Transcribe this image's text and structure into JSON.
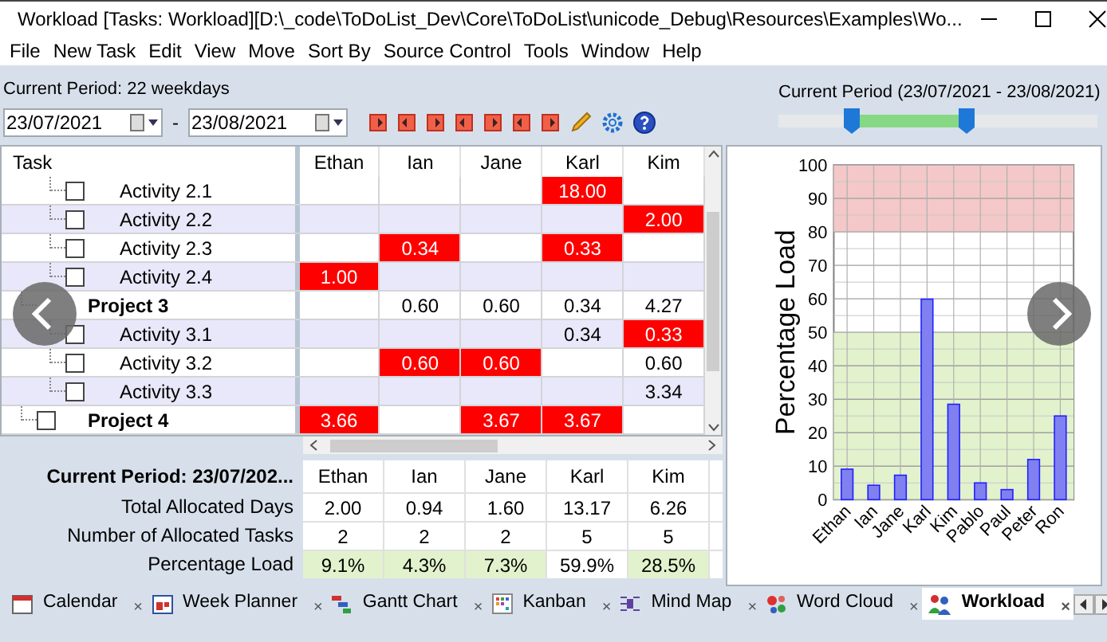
{
  "window": {
    "title": "Workload [Tasks: Workload][D:\\_code\\ToDoList_Dev\\Core\\ToDoList\\unicode_Debug\\Resources\\Examples\\Wo..."
  },
  "menu": [
    "File",
    "New Task",
    "Edit",
    "View",
    "Move",
    "Sort By",
    "Source Control",
    "Tools",
    "Window",
    "Help"
  ],
  "toolbar": {
    "period_text": "Current Period: 22 weekdays",
    "start_date": "23/07/2021",
    "separator": "-",
    "end_date": "23/08/2021",
    "slider_label": "Current Period (23/07/2021 - 23/08/2021)",
    "thumbs": [
      {
        "level": 0.23
      },
      {
        "level": 0.59
      }
    ]
  },
  "grid": {
    "task_header": "Task",
    "columns": [
      "Ethan",
      "Ian",
      "Jane",
      "Karl",
      "Kim"
    ],
    "rows": [
      {
        "task": "Activity 2.1",
        "kind": "activity",
        "checked": false,
        "cells": [
          null,
          null,
          null,
          {
            "value": "18.00",
            "over": true
          },
          null
        ]
      },
      {
        "task": "Activity 2.2",
        "kind": "activity",
        "checked": false,
        "cells": [
          null,
          null,
          null,
          null,
          {
            "value": "2.00",
            "over": true
          }
        ]
      },
      {
        "task": "Activity 2.3",
        "kind": "activity",
        "checked": false,
        "cells": [
          null,
          {
            "value": "0.34",
            "over": true
          },
          null,
          {
            "value": "0.33",
            "over": true
          },
          null
        ]
      },
      {
        "task": "Activity 2.4",
        "kind": "activity",
        "checked": false,
        "cells": [
          {
            "value": "1.00",
            "over": true
          },
          null,
          null,
          null,
          null
        ]
      },
      {
        "task": "Project 3",
        "kind": "project",
        "cells": [
          null,
          {
            "value": "0.60",
            "over": false
          },
          {
            "value": "0.60",
            "over": false
          },
          {
            "value": "0.34",
            "over": false
          },
          {
            "value": "4.27",
            "over": false
          }
        ]
      },
      {
        "task": "Activity 3.1",
        "kind": "activity",
        "checked": false,
        "cells": [
          null,
          null,
          null,
          {
            "value": "0.34",
            "over": false
          },
          {
            "value": "0.33",
            "over": true
          }
        ]
      },
      {
        "task": "Activity 3.2",
        "kind": "activity",
        "checked": false,
        "cells": [
          null,
          {
            "value": "0.60",
            "over": true
          },
          {
            "value": "0.60",
            "over": true
          },
          null,
          {
            "value": "0.60",
            "over": false
          }
        ]
      },
      {
        "task": "Activity 3.3",
        "kind": "activity",
        "checked": false,
        "cells": [
          null,
          null,
          null,
          null,
          {
            "value": "3.34",
            "over": false
          }
        ]
      },
      {
        "task": "Project 4",
        "kind": "project",
        "checked": false,
        "cells": [
          {
            "value": "3.66",
            "over": true
          },
          null,
          {
            "value": "3.67",
            "over": true
          },
          {
            "value": "3.67",
            "over": true
          },
          null
        ]
      }
    ]
  },
  "summary": {
    "title": "Current Period: 23/07/202...",
    "columns": [
      "Ethan",
      "Ian",
      "Jane",
      "Karl",
      "Kim"
    ],
    "rows": [
      {
        "label": "Total Allocated Days",
        "cells": [
          {
            "value": "2.00"
          },
          {
            "value": "0.94"
          },
          {
            "value": "1.60"
          },
          {
            "value": "13.17"
          },
          {
            "value": "6.26"
          }
        ]
      },
      {
        "label": "Number of Allocated Tasks",
        "cells": [
          {
            "value": "2"
          },
          {
            "value": "2"
          },
          {
            "value": "2"
          },
          {
            "value": "5"
          },
          {
            "value": "5"
          }
        ]
      },
      {
        "label": "Percentage Load",
        "cells": [
          {
            "value": "9.1%",
            "color": "#e2f2cc"
          },
          {
            "value": "4.3%",
            "color": "#e2f2cc"
          },
          {
            "value": "7.3%",
            "color": "#e2f2cc"
          },
          {
            "value": "59.9%",
            "color": "#ffffff"
          },
          {
            "value": "28.5%",
            "color": "#e2f2cc"
          }
        ]
      }
    ]
  },
  "chart_data": {
    "type": "bar",
    "ylabel": "Percentage Load",
    "categories": [
      "Ethan",
      "Ian",
      "Jane",
      "Karl",
      "Kim",
      "Pablo",
      "Paul",
      "Peter",
      "Ron"
    ],
    "values": [
      9.1,
      4.3,
      7.3,
      59.9,
      28.5,
      5,
      3,
      12,
      25
    ],
    "ylim": [
      0,
      100
    ],
    "yticks": [
      0,
      10,
      20,
      30,
      40,
      50,
      60,
      70,
      80,
      90,
      100
    ],
    "grid": true,
    "bands": [
      {
        "axis": "y",
        "from": 80,
        "to": 100,
        "color": "#f4c8c8"
      },
      {
        "axis": "y",
        "from": 0,
        "to": 50,
        "color": "#e2f2cc"
      }
    ]
  },
  "tabs": [
    {
      "label": "Calendar",
      "selected": false
    },
    {
      "label": "Week Planner",
      "selected": false
    },
    {
      "label": "Gantt Chart",
      "selected": false
    },
    {
      "label": "Kanban",
      "selected": false
    },
    {
      "label": "Mind Map",
      "selected": false
    },
    {
      "label": "Word Cloud",
      "selected": false
    },
    {
      "label": "Workload",
      "selected": true
    }
  ],
  "tab_close": "×"
}
